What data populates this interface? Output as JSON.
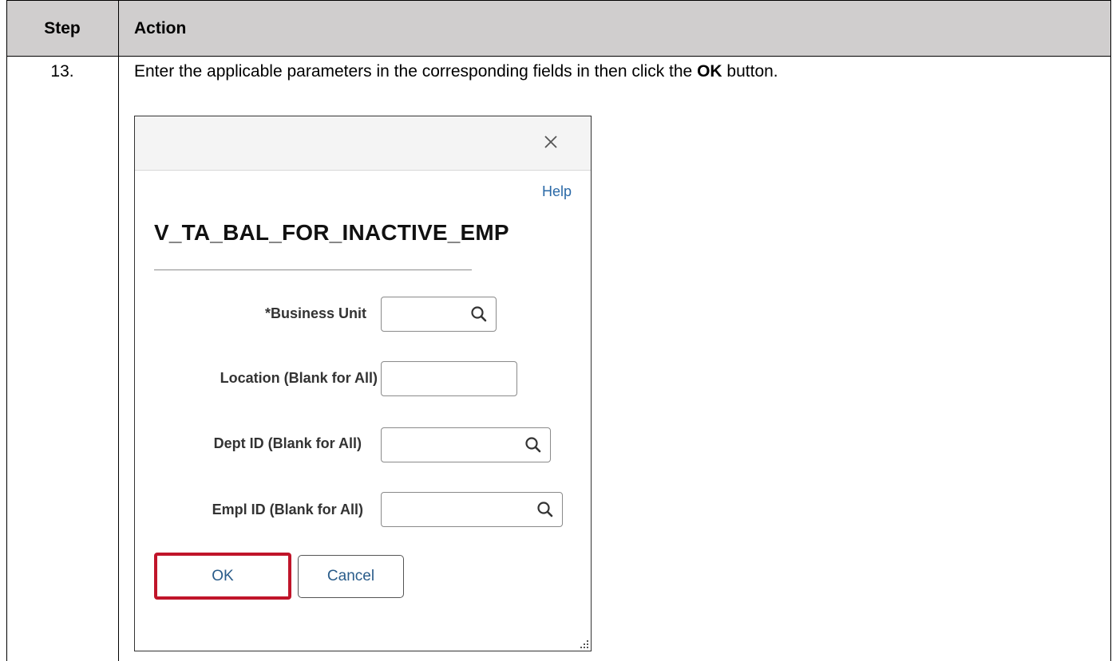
{
  "table": {
    "header_step": "Step",
    "header_action": "Action",
    "header_bg": "#d0cece"
  },
  "row": {
    "step_number": "13.",
    "instruction_prefix": "Enter the applicable parameters in the corresponding fields in then click the ",
    "instruction_bold": "OK",
    "instruction_suffix": " button."
  },
  "dialog": {
    "close_icon": "close-icon",
    "help_label": "Help",
    "title": "V_TA_BAL_FOR_INACTIVE_EMP",
    "fields": [
      {
        "label": "*Business Unit",
        "value": "",
        "has_search": true
      },
      {
        "label": "Location (Blank for All)",
        "value": "",
        "has_search": false
      },
      {
        "label": "Dept ID (Blank for All)",
        "value": "",
        "has_search": true
      },
      {
        "label": "Empl ID (Blank for All)",
        "value": "",
        "has_search": true
      }
    ],
    "ok_label": "OK",
    "cancel_label": "Cancel",
    "highlight_color": "#c0152a",
    "link_color": "#2a69a7"
  }
}
